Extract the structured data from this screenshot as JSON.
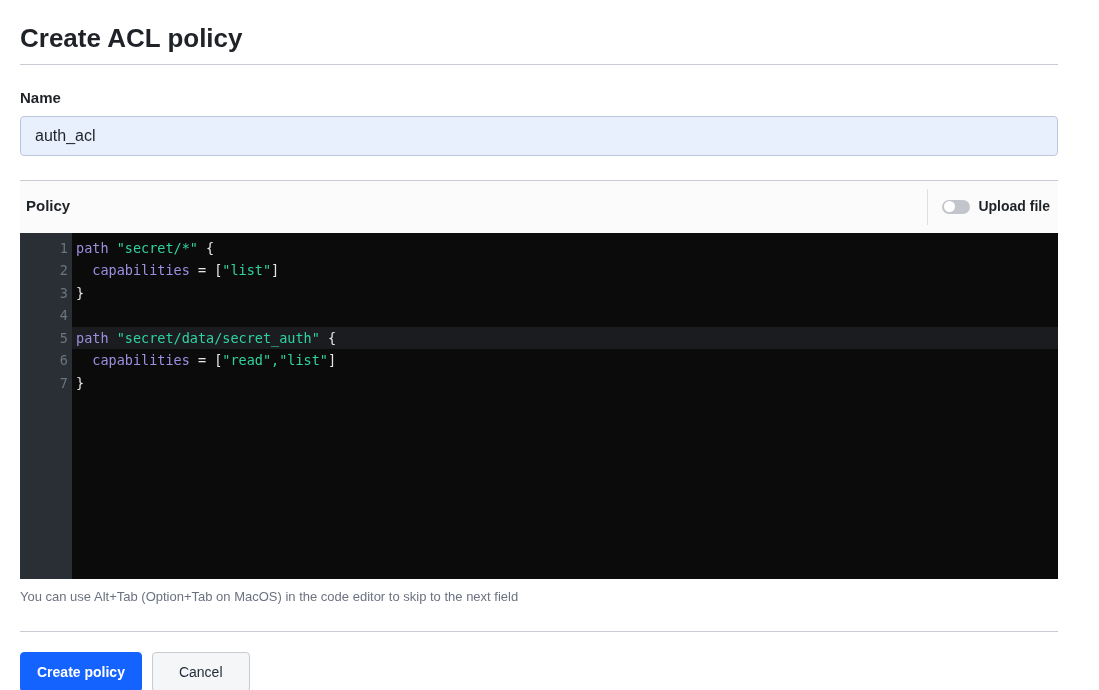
{
  "page_title": "Create ACL policy",
  "name_field": {
    "label": "Name",
    "value": "auth_acl"
  },
  "policy": {
    "label": "Policy",
    "upload_toggle": {
      "label": "Upload file",
      "on": false
    },
    "lines": [
      {
        "number": "1",
        "selected": false,
        "tokens": [
          {
            "kind": "keyword",
            "text": "path"
          },
          {
            "kind": "string",
            "text": " \"secret/*\""
          },
          {
            "kind": "plain",
            "text": " {"
          }
        ]
      },
      {
        "number": "2",
        "selected": false,
        "tokens": [
          {
            "kind": "keyword",
            "text": "  capabilities"
          },
          {
            "kind": "plain",
            "text": " = ["
          },
          {
            "kind": "string",
            "text": "\"list\""
          },
          {
            "kind": "plain",
            "text": "]"
          }
        ]
      },
      {
        "number": "3",
        "selected": false,
        "tokens": [
          {
            "kind": "plain",
            "text": "}"
          }
        ]
      },
      {
        "number": "4",
        "selected": false
      },
      {
        "number": "5",
        "selected": true,
        "tokens": [
          {
            "kind": "keyword",
            "text": "path"
          },
          {
            "kind": "string",
            "text": " \"secret/data/secret_auth\""
          },
          {
            "kind": "plain",
            "text": " {"
          }
        ]
      },
      {
        "number": "6",
        "selected": false,
        "tokens": [
          {
            "kind": "keyword",
            "text": "  capabilities"
          },
          {
            "kind": "plain",
            "text": " = ["
          },
          {
            "kind": "string",
            "text": "\"read\",\"list\""
          },
          {
            "kind": "plain",
            "text": "]"
          }
        ]
      },
      {
        "number": "7",
        "selected": false,
        "tokens": [
          {
            "kind": "plain",
            "text": "}"
          }
        ]
      }
    ],
    "help_text": "You can use Alt+Tab (Option+Tab on MacOS) in the code editor to skip to the next field"
  },
  "buttons": [
    {
      "label": "Create policy",
      "kind": "primary"
    },
    {
      "label": "Cancel",
      "kind": "secondary"
    }
  ]
}
